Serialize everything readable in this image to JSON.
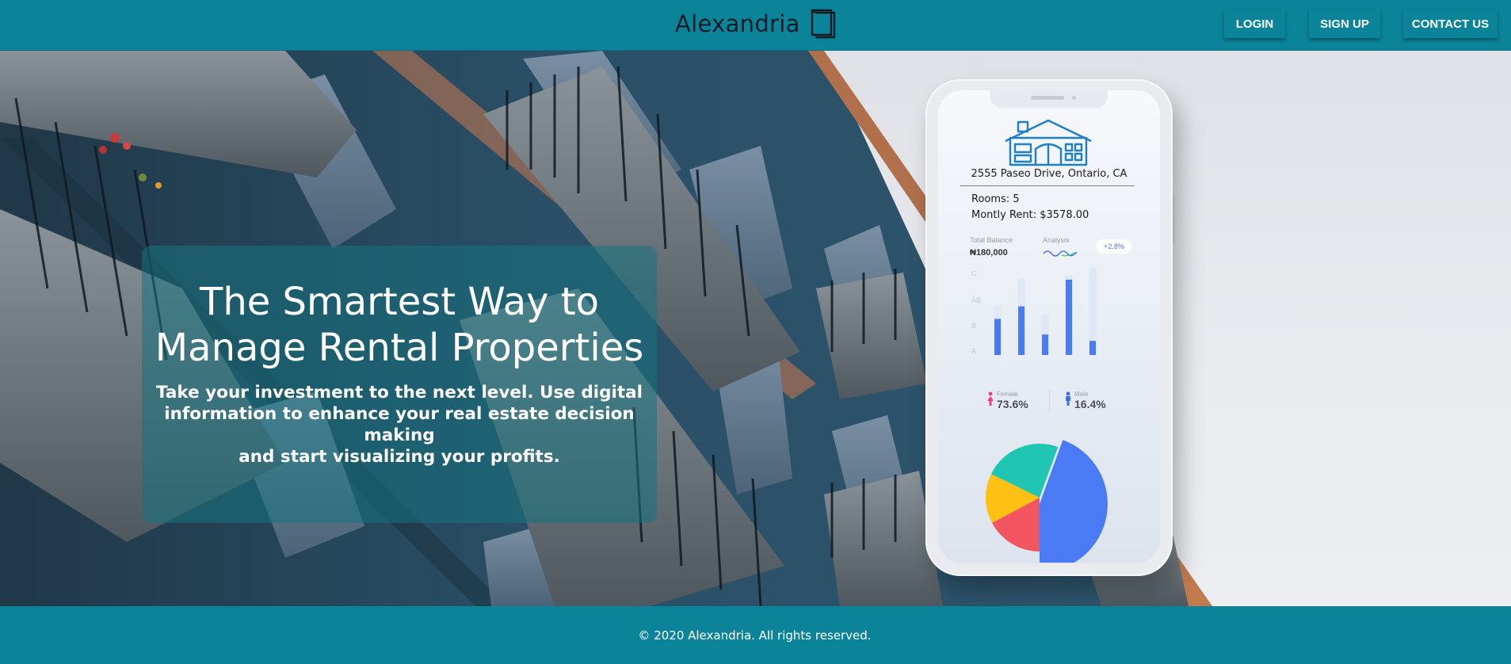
{
  "header": {
    "brand_name": "Alexandria",
    "nav": {
      "login": "LOGIN",
      "signup": "SIGN UP",
      "contact": "CONTACT US"
    }
  },
  "hero": {
    "title_line1": "The Smartest Way to",
    "title_line2": "Manage Rental Properties",
    "subtitle_line1": "Take your investment to the next level. Use digital",
    "subtitle_line2": "information to enhance your real estate decision making",
    "subtitle_line3": "and start visualizing your profits."
  },
  "phone": {
    "address": "2555 Paseo Drive, Ontario, CA",
    "rooms": "Rooms: 5",
    "rent": "Montly Rent: $3578.00",
    "total_balance_label": "Total Balance",
    "total_balance_value": "₦180,000",
    "analysis_label": "Analysis",
    "change_badge": "+2.8%",
    "bar_axis_labels": [
      "C",
      "AB",
      "B",
      "A"
    ],
    "bar_values": [
      0.46,
      0.62,
      0.26,
      0.96,
      0.18
    ],
    "bar_track_values": [
      0.56,
      0.88,
      0.46,
      0.92,
      1.0
    ],
    "female_label": "Female",
    "female_value": "73.6%",
    "male_label": "Male",
    "male_value": "16.4%",
    "pie_slices": [
      {
        "color": "#4a7af4"
      },
      {
        "color": "#f2555f"
      },
      {
        "color": "#fdc013"
      },
      {
        "color": "#20c6b2"
      }
    ]
  },
  "colors": {
    "brand": "#0b8499",
    "chart_blue": "#4a7af4",
    "female": "#e83e8c",
    "male": "#3b6fe0"
  },
  "icons": {
    "brand_logo": "book-icon",
    "house": "house-icon",
    "female": "female-icon",
    "male": "male-icon"
  },
  "footer": {
    "text": "© 2020 Alexandria. All rights reserved."
  }
}
